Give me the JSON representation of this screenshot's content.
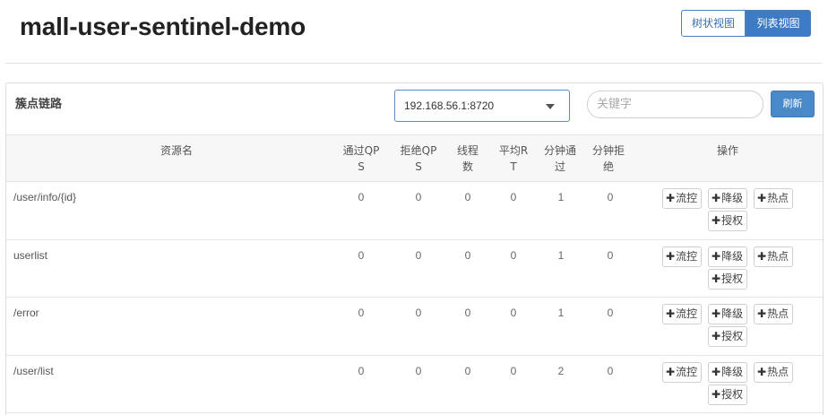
{
  "app": {
    "title": "mall-user-sentinel-demo",
    "view_tree_label": "树状视图",
    "view_list_label": "列表视图"
  },
  "panel": {
    "title": "簇点链路",
    "machine_select_value": "192.168.56.1:8720",
    "search_placeholder": "关键字",
    "refresh_label": "刷新"
  },
  "table": {
    "headers": {
      "resource": "资源名",
      "pass_qps": "通过QPS",
      "block_qps": "拒绝QPS",
      "threads": "线程数",
      "avg_rt": "平均RT",
      "minute_pass": "分钟通过",
      "minute_block": "分钟拒绝",
      "actions": "操作"
    },
    "rows": [
      {
        "resource": "/user/info/{id}",
        "pass_qps": "0",
        "block_qps": "0",
        "threads": "0",
        "avg_rt": "0",
        "minute_pass": "1",
        "minute_block": "0"
      },
      {
        "resource": "userlist",
        "pass_qps": "0",
        "block_qps": "0",
        "threads": "0",
        "avg_rt": "0",
        "minute_pass": "1",
        "minute_block": "0"
      },
      {
        "resource": "/error",
        "pass_qps": "0",
        "block_qps": "0",
        "threads": "0",
        "avg_rt": "0",
        "minute_pass": "1",
        "minute_block": "0"
      },
      {
        "resource": "/user/list",
        "pass_qps": "0",
        "block_qps": "0",
        "threads": "0",
        "avg_rt": "0",
        "minute_pass": "2",
        "minute_block": "0"
      }
    ],
    "actions": {
      "plus": "✚",
      "flow": "流控",
      "degrade": "降级",
      "hot": "热点",
      "auth": "授权"
    }
  },
  "colors": {
    "accent": "#3d7bc4",
    "refresh": "#4a89c8"
  }
}
